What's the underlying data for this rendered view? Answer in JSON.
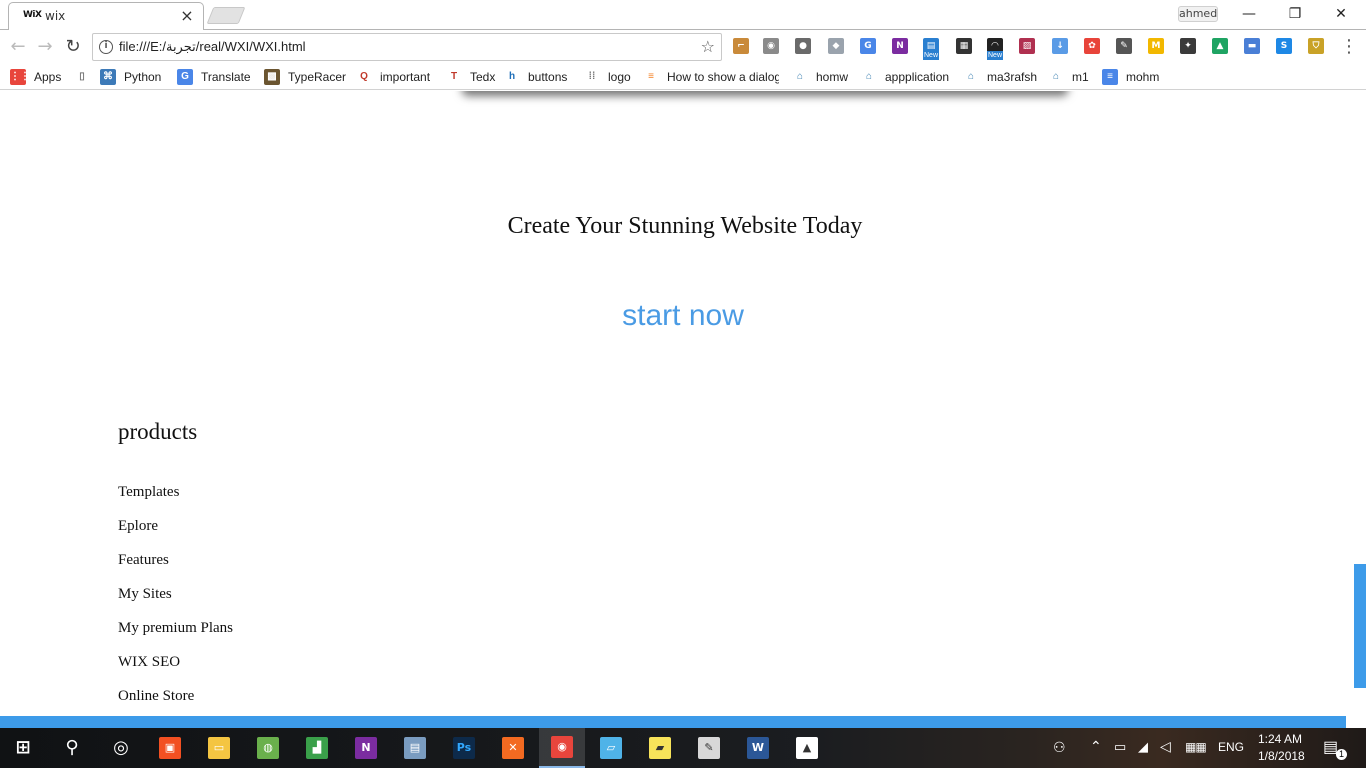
{
  "window": {
    "tab_favicon": "WiX",
    "tab_title": "wix",
    "tab_close": "×",
    "profile_name": "ahmed",
    "minimize": "—",
    "restore": "❐",
    "close": "✕"
  },
  "toolbar": {
    "back": "←",
    "forward": "→",
    "reload": "↻",
    "url": "file:///E:/تجربة/real/WXI/WXI.html",
    "star": "☆",
    "menu": "⋮",
    "extensions": [
      {
        "icon": "ruler-icon",
        "color": "#c98a3a",
        "glyph": "⌐"
      },
      {
        "icon": "camera-icon",
        "color": "#8a8a8a",
        "glyph": "◉"
      },
      {
        "icon": "bulb-icon",
        "color": "#6a6a6a",
        "glyph": "●"
      },
      {
        "icon": "dropbox-icon",
        "color": "#9aa3ad",
        "glyph": "◆"
      },
      {
        "icon": "translate-icon",
        "color": "#4a86e8",
        "glyph": "G"
      },
      {
        "icon": "onenote-icon",
        "color": "#7b2ca0",
        "glyph": "N"
      },
      {
        "icon": "new-badge-icon",
        "color": "#2a7fd0",
        "glyph": "▤"
      },
      {
        "icon": "film-icon",
        "color": "#333333",
        "glyph": "▦"
      },
      {
        "icon": "speed-icon",
        "color": "#222222",
        "glyph": "◠"
      },
      {
        "icon": "picture-icon",
        "color": "#b03050",
        "glyph": "▨"
      },
      {
        "icon": "download-icon",
        "color": "#5a9be6",
        "glyph": "↓"
      },
      {
        "icon": "color-wheel-icon",
        "color": "#e8443a",
        "glyph": "✿"
      },
      {
        "icon": "eyedropper-icon",
        "color": "#555555",
        "glyph": "✎"
      },
      {
        "icon": "m-icon",
        "color": "#f2b800",
        "glyph": "M"
      },
      {
        "icon": "evernote-icon",
        "color": "#3a3a3a",
        "glyph": "✦"
      },
      {
        "icon": "drive-icon",
        "color": "#1fa463",
        "glyph": "▲"
      },
      {
        "icon": "folder-icon",
        "color": "#4a7fd6",
        "glyph": "▬"
      },
      {
        "icon": "s-icon",
        "color": "#1e88e5",
        "glyph": "S"
      },
      {
        "icon": "shield-icon",
        "color": "#c9a227",
        "glyph": "⛉"
      }
    ],
    "new_badges": [
      "New",
      "New"
    ]
  },
  "bookmarks": [
    {
      "label": "Apps",
      "icon": "apps-grid-icon",
      "color": "#e8453c",
      "glyph": "⋮⋮"
    },
    {
      "label": "",
      "icon": "page-icon",
      "color": "#ffffff",
      "glyph": "▯"
    },
    {
      "label": "Python",
      "icon": "python-icon",
      "color": "#3d7ab8",
      "glyph": "⌘"
    },
    {
      "label": "Translate",
      "icon": "translate-icon",
      "color": "#4a86e8",
      "glyph": "G"
    },
    {
      "label": "TypeRacer",
      "icon": "typeracer-icon",
      "color": "#6b5530",
      "glyph": "▩"
    },
    {
      "label": "important",
      "icon": "quora-icon",
      "color": "#ffffff",
      "glyph": "Q"
    },
    {
      "label": "Tedx",
      "icon": "tedx-icon",
      "color": "#ffffff",
      "glyph": "T"
    },
    {
      "label": "buttons",
      "icon": "hm-icon",
      "color": "#ffffff",
      "glyph": "h"
    },
    {
      "label": "logo",
      "icon": "dots-icon",
      "color": "#ffffff",
      "glyph": "⁞⁞"
    },
    {
      "label": "How to show a dialog",
      "icon": "stackoverflow-icon",
      "color": "#ffffff",
      "glyph": "≡"
    },
    {
      "label": "homw",
      "icon": "uwc-icon",
      "color": "#ffffff",
      "glyph": "⌂"
    },
    {
      "label": "appplication",
      "icon": "uwc-icon",
      "color": "#ffffff",
      "glyph": "⌂"
    },
    {
      "label": "ma3rafsh",
      "icon": "uwc-icon",
      "color": "#ffffff",
      "glyph": "⌂"
    },
    {
      "label": "m1",
      "icon": "uwc-icon",
      "color": "#ffffff",
      "glyph": "⌂"
    },
    {
      "label": "mohm",
      "icon": "doc-icon",
      "color": "#4a86e8",
      "glyph": "≡"
    }
  ],
  "page": {
    "hero_title": "Create Your Stunning Website Today",
    "cta_label": "start now",
    "footer_heading": "products",
    "footer_links": [
      "Templates",
      "Eplore",
      "Features",
      "My Sites",
      "My premium Plans",
      "WIX SEO",
      "Online Store"
    ],
    "accent_color": "#4a9be4"
  },
  "taskbar": {
    "apps": [
      {
        "icon": "start-icon",
        "color": "#ffffff",
        "glyph": "⊞"
      },
      {
        "icon": "search-icon",
        "color": "#ffffff",
        "glyph": "⚲"
      },
      {
        "icon": "cortana-icon",
        "color": "#ffffff",
        "glyph": "◎"
      },
      {
        "icon": "store-icon",
        "color": "#f25022",
        "glyph": "▣"
      },
      {
        "icon": "file-explorer-icon",
        "color": "#f4c542",
        "glyph": "▭"
      },
      {
        "icon": "android-studio-icon",
        "color": "#6ab04c",
        "glyph": "◍"
      },
      {
        "icon": "chart-app-icon",
        "color": "#3aa04a",
        "glyph": "▟"
      },
      {
        "icon": "onenote-icon",
        "color": "#7b2ca0",
        "glyph": "N"
      },
      {
        "icon": "control-panel-icon",
        "color": "#7a9cc0",
        "glyph": "▤"
      },
      {
        "icon": "photoshop-icon",
        "color": "#0d2a4a",
        "glyph": "Ps"
      },
      {
        "icon": "xampp-icon",
        "color": "#f36a21",
        "glyph": "✕"
      },
      {
        "icon": "chrome-icon",
        "color": "#e8453c",
        "glyph": "◉"
      },
      {
        "icon": "notepad-icon",
        "color": "#4fb3e8",
        "glyph": "▱"
      },
      {
        "icon": "sticky-notes-icon",
        "color": "#f7e35a",
        "glyph": "▰"
      },
      {
        "icon": "paint-icon",
        "color": "#d8d8d8",
        "glyph": "✎"
      },
      {
        "icon": "word-icon",
        "color": "#2b5797",
        "glyph": "W"
      },
      {
        "icon": "photos-icon",
        "color": "#ffffff",
        "glyph": "▲"
      }
    ],
    "language": "ENG",
    "time": "1:24 AM",
    "date": "1/8/2018",
    "notification_count": "1"
  }
}
